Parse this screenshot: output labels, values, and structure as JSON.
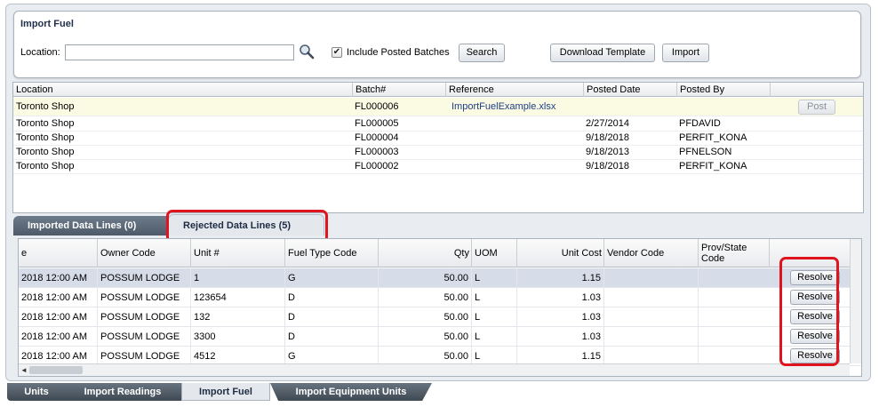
{
  "import_fuel": {
    "title": "Import Fuel",
    "location_label": "Location:",
    "location_value": "",
    "include_posted_label": "Include Posted Batches",
    "include_posted_checked": "✔",
    "search_label": "Search",
    "download_template_label": "Download Template",
    "import_label": "Import"
  },
  "batches": {
    "columns": [
      "Location",
      "Batch#",
      "Reference",
      "Posted Date",
      "Posted By"
    ],
    "rows": [
      {
        "location": "Toronto Shop",
        "batch": "FL000006",
        "reference": "ImportFuelExample.xlsx",
        "posted_date": "",
        "posted_by": "",
        "action": "Post"
      },
      {
        "location": "Toronto Shop",
        "batch": "FL000005",
        "reference": "",
        "posted_date": "2/27/2014",
        "posted_by": "PFDAVID"
      },
      {
        "location": "Toronto Shop",
        "batch": "FL000004",
        "reference": "",
        "posted_date": "9/18/2018",
        "posted_by": "PERFIT_KONA"
      },
      {
        "location": "Toronto Shop",
        "batch": "FL000003",
        "reference": "",
        "posted_date": "9/18/2013",
        "posted_by": "PFNELSON"
      },
      {
        "location": "Toronto Shop",
        "batch": "FL000002",
        "reference": "",
        "posted_date": "9/18/2018",
        "posted_by": "PERFIT_KONA"
      }
    ]
  },
  "tabs": {
    "imported": "Imported Data Lines (0)",
    "rejected": "Rejected Data Lines (5)"
  },
  "rejected_lines": {
    "columns": [
      "e",
      "Owner Code",
      "Unit #",
      "Fuel Type Code",
      "Qty",
      "UOM",
      "Unit Cost",
      "Vendor Code",
      "Prov/State Code"
    ],
    "rows": [
      {
        "date": "2018 12:00 AM",
        "owner": "POSSUM LODGE",
        "unit": "1",
        "fuel_type": "G",
        "qty": "50.00",
        "uom": "L",
        "unit_cost": "1.15",
        "vendor": "",
        "prov": "",
        "action": "Resolve"
      },
      {
        "date": "2018 12:00 AM",
        "owner": "POSSUM LODGE",
        "unit": "123654",
        "fuel_type": "D",
        "qty": "50.00",
        "uom": "L",
        "unit_cost": "1.03",
        "vendor": "",
        "prov": "",
        "action": "Resolve"
      },
      {
        "date": "2018 12:00 AM",
        "owner": "POSSUM LODGE",
        "unit": "132",
        "fuel_type": "D",
        "qty": "50.00",
        "uom": "L",
        "unit_cost": "1.03",
        "vendor": "",
        "prov": "",
        "action": "Resolve"
      },
      {
        "date": "2018 12:00 AM",
        "owner": "POSSUM LODGE",
        "unit": "3300",
        "fuel_type": "D",
        "qty": "50.00",
        "uom": "L",
        "unit_cost": "1.03",
        "vendor": "",
        "prov": "",
        "action": "Resolve"
      },
      {
        "date": "2018 12:00 AM",
        "owner": "POSSUM LODGE",
        "unit": "4512",
        "fuel_type": "G",
        "qty": "50.00",
        "uom": "L",
        "unit_cost": "1.15",
        "vendor": "",
        "prov": "",
        "action": "Resolve"
      }
    ]
  },
  "bottom_tabs": [
    "Units",
    "Import Readings",
    "Import Fuel",
    "Import Equipment Units"
  ],
  "icons": {
    "search": "magnifier-icon",
    "scroll_left": "◄"
  },
  "colors": {
    "highlight_red": "#e0141e",
    "selected_row": "#fbfbe4"
  }
}
